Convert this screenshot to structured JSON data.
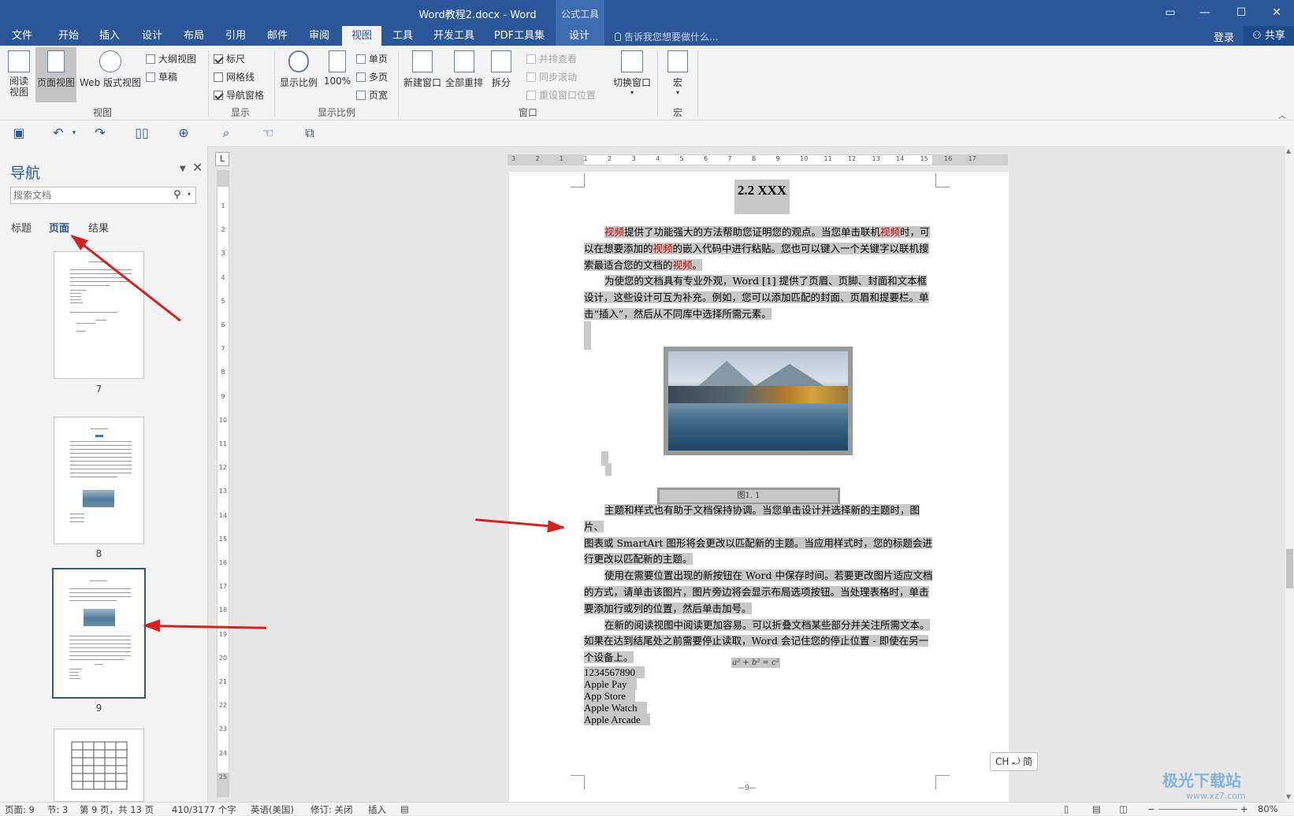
{
  "window": {
    "title": "Word教程2.docx - Word",
    "context_tab_group": "公式工具",
    "controls": [
      "▭",
      "—",
      "☐",
      "✕"
    ]
  },
  "tabs": [
    "文件",
    "开始",
    "插入",
    "设计",
    "布局",
    "引用",
    "邮件",
    "审阅",
    "视图",
    "工具",
    "开发工具",
    "PDF工具集",
    "设计"
  ],
  "active_tab": "视图",
  "tell_me": "告诉我您想要做什么...",
  "account": {
    "login": "登录",
    "share": "共享"
  },
  "ribbon": {
    "views": {
      "read": "阅读\n视图",
      "print": "页面视图",
      "web": "Web 版式视图",
      "outline": "大纲视图",
      "draft": "草稿",
      "label": "视图"
    },
    "show": {
      "ruler": "标尺",
      "gridlines": "网格线",
      "navpane": "导航窗格",
      "label": "显示",
      "ruler_checked": true,
      "gridlines_checked": false,
      "navpane_checked": true
    },
    "zoom": {
      "zoom": "显示比例",
      "hundred": "100%",
      "single": "单页",
      "multi": "多页",
      "pagewidth": "页宽",
      "label": "显示比例"
    },
    "window": {
      "new": "新建窗口",
      "arrange": "全部重排",
      "split": "拆分",
      "side_by_side": "并排查看",
      "sync_scroll": "同步滚动",
      "reset_pos": "重设窗口位置",
      "switch": "切换窗口",
      "label": "窗口"
    },
    "macros": {
      "macro": "宏",
      "label": "宏"
    }
  },
  "nav": {
    "title": "导航",
    "search_placeholder": "搜索文档",
    "tabs": [
      "标题",
      "页面",
      "结果"
    ],
    "active_tab": "页面",
    "pages": [
      "7",
      "8",
      "9"
    ],
    "selected_page": "9"
  },
  "ruler": {
    "h_marks": [
      "3",
      "2",
      "1",
      "1",
      "2",
      "3",
      "4",
      "5",
      "6",
      "7",
      "8",
      "9",
      "10",
      "11",
      "12",
      "13",
      "14",
      "15",
      "16",
      "17"
    ],
    "v_marks": [
      "1",
      "2",
      "3",
      "4",
      "5",
      "6",
      "7",
      "8",
      "9",
      "10",
      "11",
      "12",
      "13",
      "14",
      "15",
      "16",
      "17",
      "18",
      "19",
      "20",
      "21",
      "22",
      "23",
      "24",
      "25"
    ],
    "tab_marker": "L"
  },
  "document": {
    "heading": "2.2 XXX",
    "p1_parts": [
      "视频",
      "提供了功能强大的方法帮助您证明您的观点。当您单击联机",
      "视频",
      "时，可以在想要添加的",
      "视频",
      "的嵌入代码中进行粘贴。您也可以键入一个关键字以联机搜索最适合您的文档的",
      "视频",
      "。"
    ],
    "p2": "为使您的文档具有专业外观，Word [1] 提供了页眉、页脚、封面和文本框设计，这些设计可互为补充。例如，您可以添加匹配的封面、页眉和提要栏。单击“插入”，然后从不同库中选择所需元素。",
    "caption": "图1. 1",
    "p3a": "主题和样式也有助于文档保持协调。当您单击设计并选择新的主题时，图片、",
    "p3b": "图表或 SmartArt 图形将会更改以匹配新的主题。当应用样式时，您的标题会进行更改以匹配新的主题。",
    "p4": "使用在需要位置出现的新按钮在 Word 中保存时间。若要更改图片适应文档的方式，请单击该图片，图片旁边将会显示布局选项按钮。当处理表格时，单击要添加行或列的位置，然后单击加号。",
    "p5": "在新的阅读视图中阅读更加容易。可以折叠文档某些部分并关注所需文本。如果在达到结尾处之前需要停止读取，Word 会记住您的停止位置 - 即使在另一个设备上。",
    "equation": "a² + b² = c²",
    "list": [
      "1234567890",
      "Apple Pay",
      "App Store",
      "Apple Watch",
      "Apple Arcade"
    ],
    "page_footer": "—9—"
  },
  "ime": "CH ⤾ 简",
  "status": {
    "page": "页面: 9",
    "section": "节: 3",
    "pageof": "第 9 页，共 13 页",
    "words": "410/3177 个字",
    "lang": "英语(美国)",
    "track": "修订: 关闭",
    "insert": "插入",
    "zoom": "80%"
  },
  "watermark": {
    "brand": "极光下载站",
    "url": "www.xz7.com"
  },
  "colors": {
    "brand": "#2b579a",
    "annotation_arrow": "#d92020",
    "highlight": "#c8c8c8"
  }
}
